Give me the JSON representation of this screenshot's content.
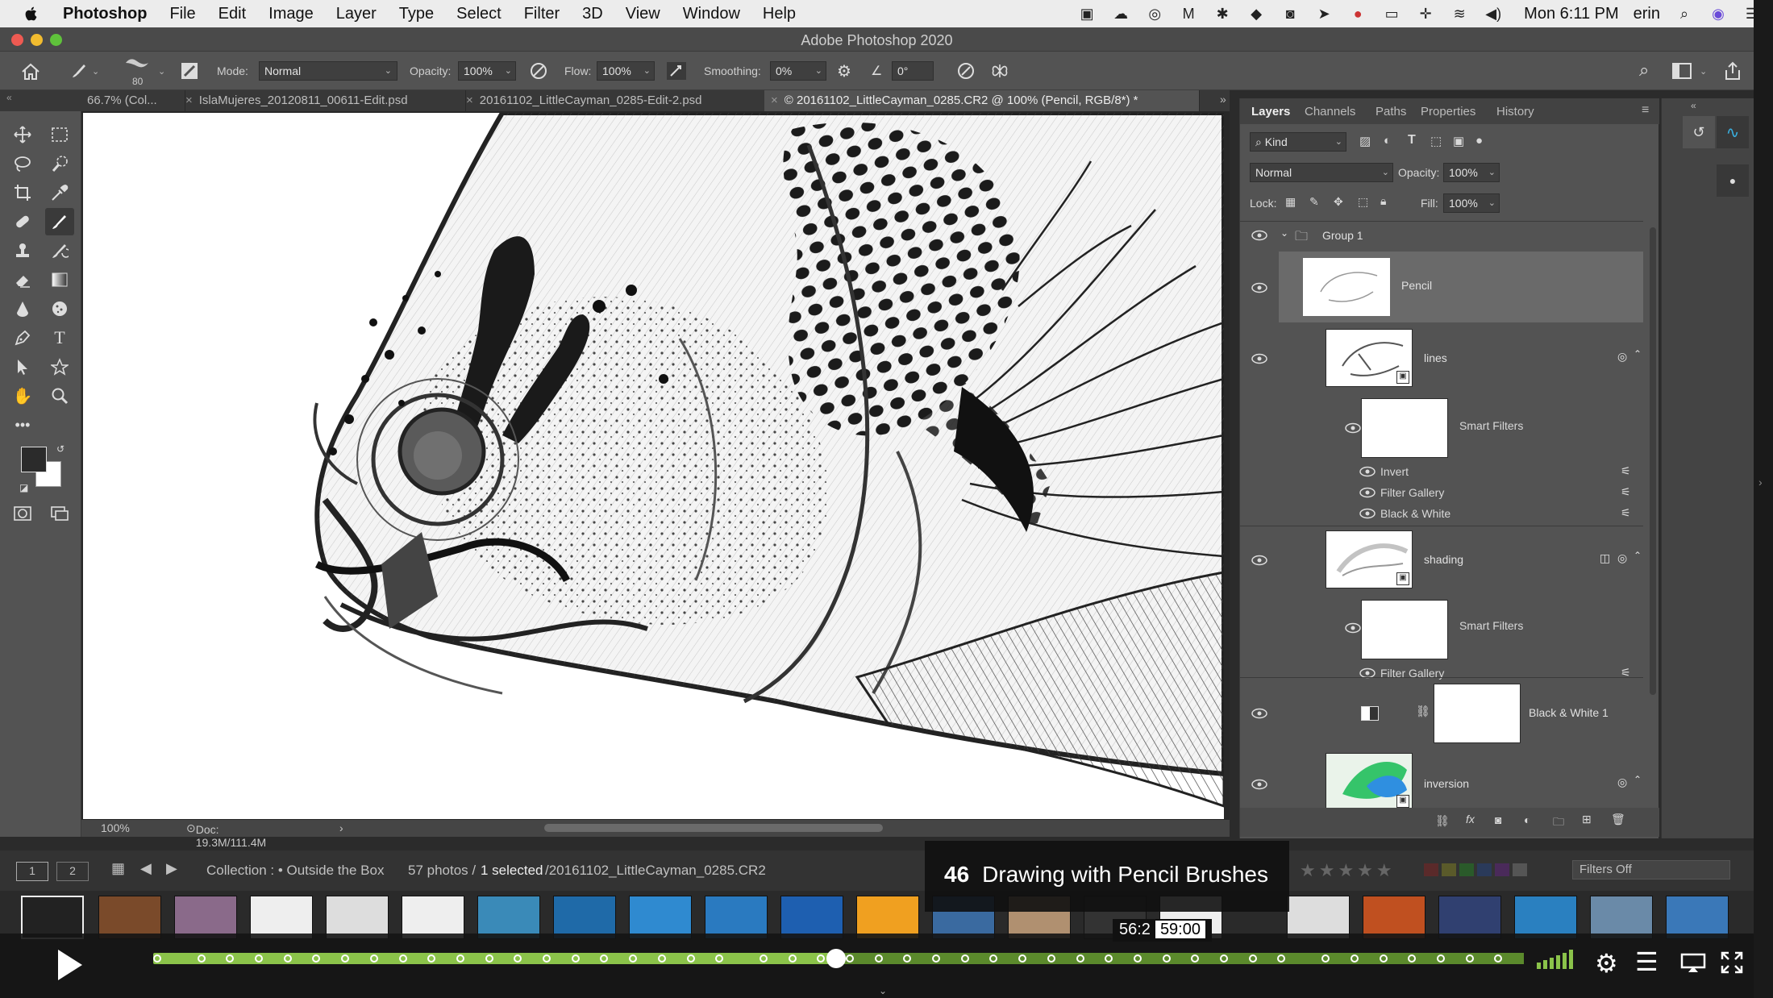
{
  "menubar": {
    "app": "Photoshop",
    "items": [
      "File",
      "Edit",
      "Image",
      "Layer",
      "Type",
      "Select",
      "Filter",
      "3D",
      "View",
      "Window",
      "Help"
    ],
    "clock": "Mon 6:11 PM",
    "user": "erin"
  },
  "window": {
    "title": "Adobe Photoshop 2020"
  },
  "options": {
    "brush_size": "80",
    "mode_label": "Mode:",
    "mode_value": "Normal",
    "opacity_label": "Opacity:",
    "opacity_value": "100%",
    "flow_label": "Flow:",
    "flow_value": "100%",
    "smoothing_label": "Smoothing:",
    "smoothing_value": "0%",
    "angle_value": "0°"
  },
  "tabs": [
    {
      "label": "66.7% (Col..."
    },
    {
      "label": "IslaMujeres_20120811_00611-Edit.psd"
    },
    {
      "label": "20161102_LittleCayman_0285-Edit-2.psd"
    },
    {
      "label": "© 20161102_LittleCayman_0285.CR2 @ 100% (Pencil, RGB/8*) *"
    }
  ],
  "status": {
    "zoom": "100%",
    "doc": "Doc: 19.3M/111.4M"
  },
  "panel": {
    "tabs": [
      "Layers",
      "Channels",
      "Paths",
      "Properties",
      "History"
    ],
    "kind_label": "Kind",
    "blend_mode": "Normal",
    "opacity_label": "Opacity:",
    "opacity_value": "100%",
    "lock_label": "Lock:",
    "fill_label": "Fill:",
    "fill_value": "100%",
    "group_name": "Group 1",
    "layers": {
      "pencil": "Pencil",
      "lines": "lines",
      "lines_smart": "Smart Filters",
      "lines_filters": [
        "Invert",
        "Filter Gallery",
        "Black & White"
      ],
      "shading": "shading",
      "shading_smart": "Smart Filters",
      "shading_filters": [
        "Filter Gallery"
      ],
      "bw": "Black & White 1",
      "inversion": "inversion"
    }
  },
  "lightroom": {
    "collection": "Collection : • Outside the Box",
    "count": "57 photos /",
    "selected": "1 selected",
    "file": "/20161102_LittleCayman_0285.CR2",
    "filters": "Filters Off",
    "page1": "1",
    "page2": "2"
  },
  "player": {
    "chapter_num": "46",
    "chapter_title": "Drawing with Pencil Brushes",
    "elapsed": "56:2",
    "hover_time": "59:00",
    "progress": 0.498
  }
}
